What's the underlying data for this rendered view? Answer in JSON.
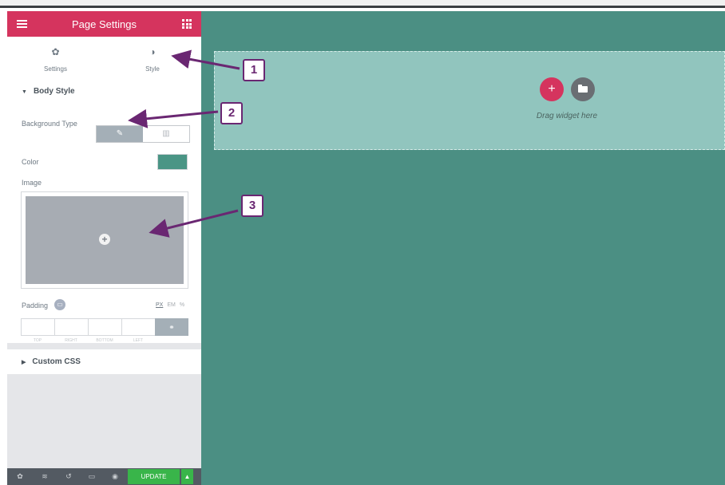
{
  "panel": {
    "title": "Page Settings",
    "tabs": [
      {
        "label": "Settings",
        "icon": "gear-icon"
      },
      {
        "label": "Style",
        "icon": "contrast-icon"
      }
    ],
    "body_style": {
      "heading": "Body Style",
      "background_type_label": "Background Type",
      "color_label": "Color",
      "color_value": "#4a9585",
      "image_label": "Image",
      "padding_label": "Padding",
      "units": [
        "PX",
        "EM",
        "%"
      ],
      "selected_unit": "PX",
      "padding_fields": [
        "TOP",
        "RIGHT",
        "BOTTOM",
        "LEFT"
      ]
    },
    "custom_css_heading": "Custom CSS",
    "footer": {
      "update_label": "UPDATE",
      "icons": [
        "gear-icon",
        "layers-icon",
        "history-icon",
        "responsive-icon",
        "eye-icon"
      ]
    }
  },
  "canvas": {
    "drop_hint": "Drag widget here",
    "background": "#4b8f83",
    "dropzone_color": "#91c5be"
  },
  "callouts": [
    "1",
    "2",
    "3"
  ],
  "colors": {
    "accent": "#d5345e",
    "callout": "#6a2772",
    "update": "#39b54a"
  }
}
